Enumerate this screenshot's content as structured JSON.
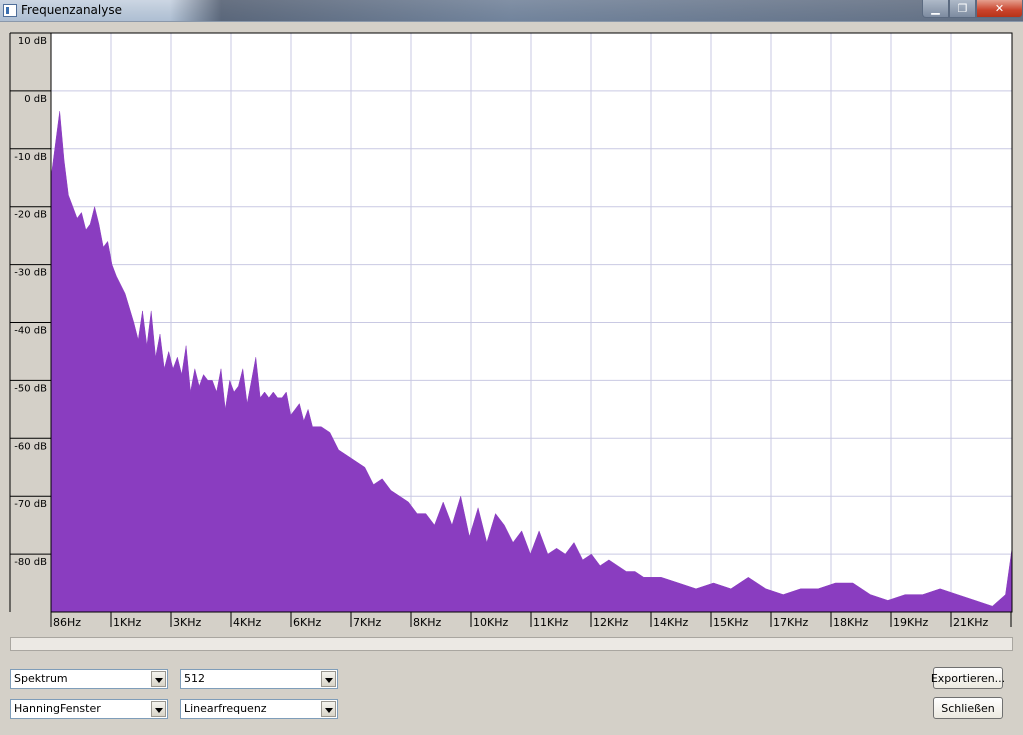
{
  "window": {
    "title": "Frequenzanalyse",
    "minimize": "▁",
    "maximize": "❐",
    "close": "✕"
  },
  "controls": {
    "mode": "Spektrum",
    "size": "512",
    "window_fn": "HanningFenster",
    "axis": "Linearfrequenz",
    "export_label": "Exportieren...",
    "close_label": "Schließen"
  },
  "chart_data": {
    "type": "area",
    "ylabel_ticks": [
      "10 dB",
      "0 dB",
      "-10 dB",
      "-20 dB",
      "-30 dB",
      "-40 dB",
      "-50 dB",
      "-60 dB",
      "-70 dB",
      "-80 dB"
    ],
    "ytick_values": [
      10,
      0,
      -10,
      -20,
      -30,
      -40,
      -50,
      -60,
      -70,
      -80
    ],
    "ylim": [
      -90,
      10
    ],
    "xtick_labels": [
      "86Hz",
      "1KHz",
      "3KHz",
      "4KHz",
      "6KHz",
      "7KHz",
      "8KHz",
      "10KHz",
      "11KHz",
      "12KHz",
      "14KHz",
      "15KHz",
      "17KHz",
      "18KHz",
      "19KHz",
      "21KHz"
    ],
    "xtick_values": [
      86,
      1000,
      3000,
      4000,
      6000,
      7000,
      8000,
      10000,
      11000,
      12000,
      14000,
      15000,
      17000,
      18000,
      19000,
      21000
    ],
    "xlim": [
      0,
      22050
    ],
    "grid": true,
    "fill_color": "#8a3dc0",
    "series": [
      {
        "x": [
          0,
          200,
          300,
          400,
          500,
          600,
          700,
          800,
          900,
          1000,
          1100,
          1200,
          1300,
          1400,
          1500,
          1700,
          1900,
          2000,
          2100,
          2200,
          2300,
          2400,
          2500,
          2600,
          2700,
          2800,
          2900,
          3000,
          3100,
          3200,
          3300,
          3400,
          3500,
          3600,
          3700,
          3800,
          3900,
          4000,
          4100,
          4200,
          4300,
          4400,
          4500,
          4600,
          4700,
          4800,
          4900,
          5000,
          5100,
          5200,
          5300,
          5400,
          5500,
          5600,
          5700,
          5800,
          5900,
          6000,
          6200,
          6400,
          6600,
          6800,
          7000,
          7200,
          7400,
          7600,
          7800,
          8000,
          8200,
          8400,
          8600,
          8800,
          9000,
          9200,
          9400,
          9600,
          9800,
          10000,
          10200,
          10400,
          10600,
          10800,
          11000,
          11200,
          11400,
          11600,
          11800,
          12000,
          12200,
          12400,
          12600,
          12800,
          13000,
          13200,
          13400,
          13600,
          13800,
          14000,
          14400,
          14800,
          15200,
          15600,
          16000,
          16400,
          16800,
          17200,
          17600,
          18000,
          18400,
          18800,
          19200,
          19600,
          20000,
          20400,
          20800,
          21200,
          21600,
          21900,
          22050
        ],
        "y": [
          -15,
          -3.5,
          -12,
          -18,
          -20,
          -22,
          -21,
          -24,
          -23,
          -20,
          -23,
          -27,
          -26,
          -30,
          -32,
          -35,
          -40,
          -43,
          -38,
          -44,
          -38,
          -46,
          -42,
          -48,
          -45,
          -48,
          -46,
          -49,
          -44,
          -52,
          -48,
          -51,
          -49,
          -50,
          -50,
          -52,
          -48,
          -55,
          -50,
          -52,
          -51,
          -48,
          -54,
          -50,
          -46,
          -53,
          -52,
          -53,
          -52,
          -53,
          -53,
          -52,
          -56,
          -55,
          -54,
          -57,
          -55,
          -58,
          -58,
          -59,
          -62,
          -63,
          -64,
          -65,
          -68,
          -67,
          -69,
          -70,
          -71,
          -73,
          -73,
          -75,
          -71,
          -75,
          -70,
          -77,
          -72,
          -78,
          -73,
          -75,
          -78,
          -76,
          -80,
          -76,
          -80,
          -79,
          -80,
          -78,
          -81,
          -80,
          -82,
          -81,
          -82,
          -83,
          -83,
          -84,
          -84,
          -84,
          -85,
          -86,
          -85,
          -86,
          -84,
          -86,
          -87,
          -86,
          -86,
          -85,
          -85,
          -87,
          -88,
          -87,
          -87,
          -86,
          -87,
          -88,
          -89,
          -87,
          -79
        ]
      }
    ]
  }
}
